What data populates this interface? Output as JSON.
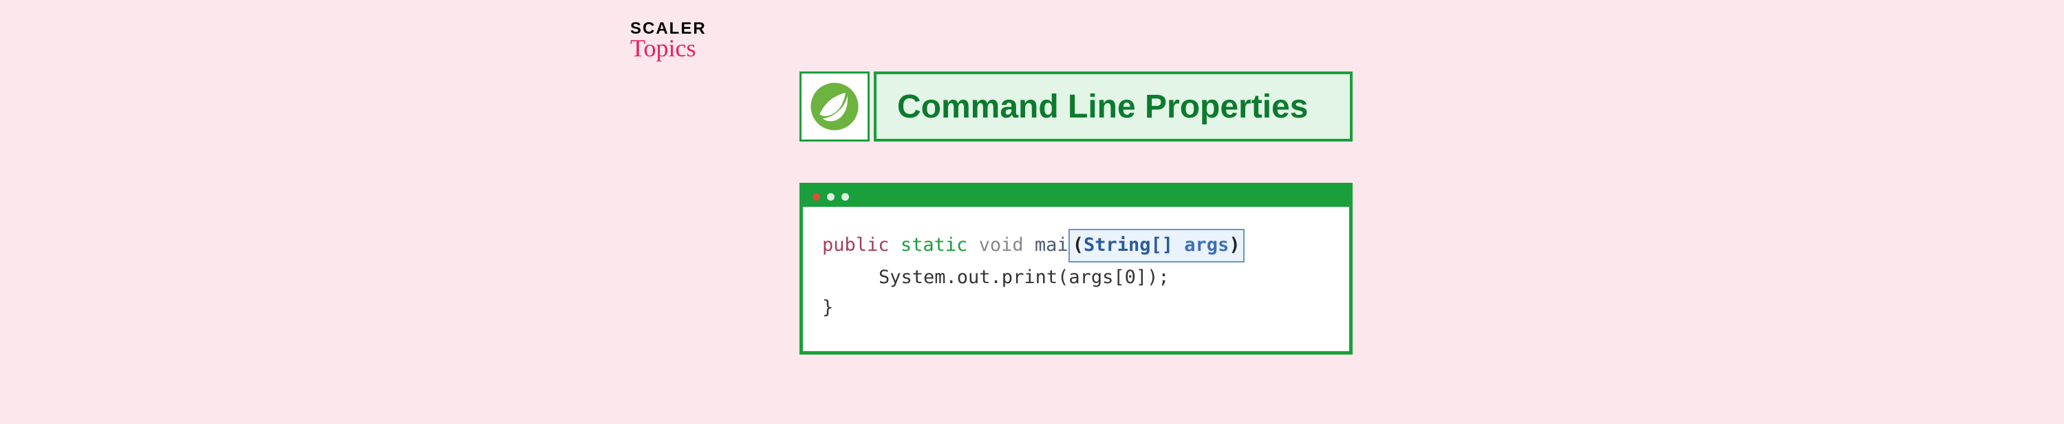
{
  "logo": {
    "line1": "SCALER",
    "line2": "Topics"
  },
  "header": {
    "title": "Command Line Properties"
  },
  "code": {
    "line1": {
      "kw_public": "public",
      "kw_static": "static",
      "kw_void": "void",
      "fn": "mai",
      "hl_open": "(",
      "hl_type": "String[]",
      "hl_name": "args",
      "hl_close": ")"
    },
    "line2": "System.out.print(args[0]);",
    "line3": "}"
  }
}
